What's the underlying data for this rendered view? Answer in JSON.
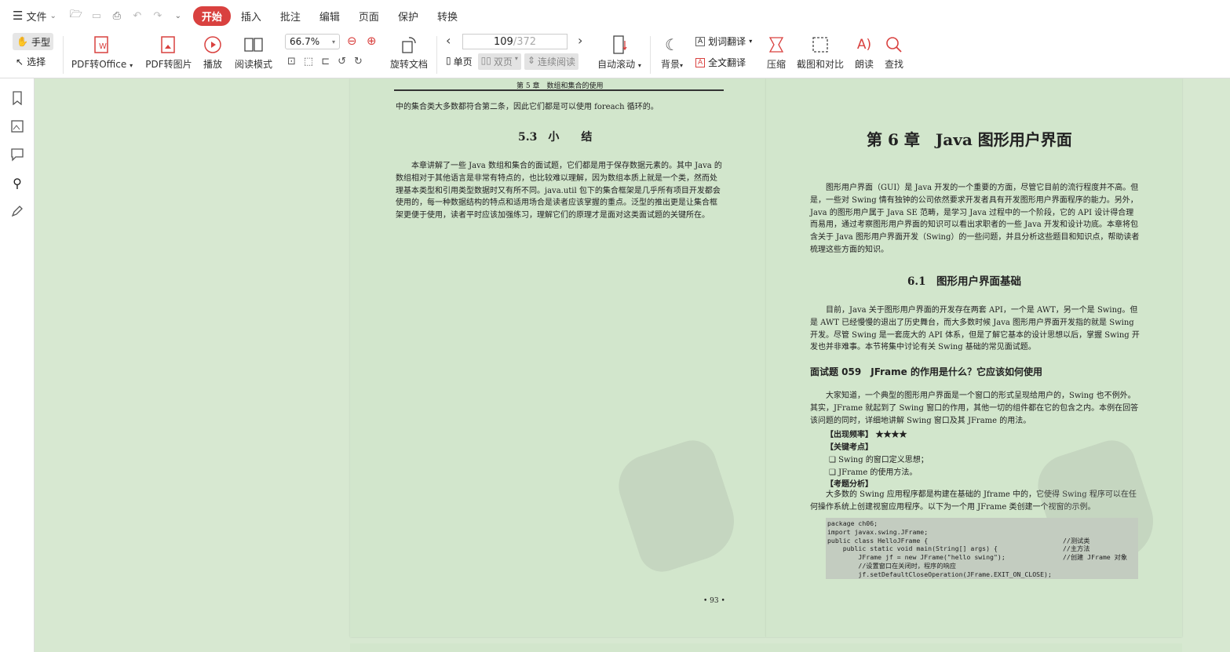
{
  "menubar": {
    "file_label": "文件",
    "tabs": [
      {
        "label": "开始",
        "active": true
      },
      {
        "label": "插入",
        "active": false
      },
      {
        "label": "批注",
        "active": false
      },
      {
        "label": "编辑",
        "active": false
      },
      {
        "label": "页面",
        "active": false
      },
      {
        "label": "保护",
        "active": false
      },
      {
        "label": "转换",
        "active": false
      }
    ]
  },
  "toolbar": {
    "hand_label": "手型",
    "select_label": "选择",
    "pdf_office": "PDF转Office",
    "pdf_image": "PDF转图片",
    "play": "播放",
    "read_mode": "阅读模式",
    "zoom": "66.7%",
    "rotate_doc": "旋转文档",
    "page_current": "109",
    "page_total": "/372",
    "single": "单页",
    "double": "双页",
    "continuous": "连续阅读",
    "auto_scroll": "自动滚动",
    "background": "背景",
    "word_translate": "划词翻译",
    "full_translate": "全文翻译",
    "compress": "压缩",
    "screenshot_compare": "截图和对比",
    "read_aloud": "朗读",
    "find": "查找"
  },
  "colors": {
    "accent": "#d9413f",
    "page_bg": "#d2e6cc",
    "area_bg": "#d7e8d1"
  },
  "left_page": {
    "running_head": "第 5 章　数组和集合的使用",
    "top_line": "中的集合类大多数都符合第二条，因此它们都是可以使用 foreach 循环的。",
    "section_title": "5.3　小　　结",
    "paragraph": "本章讲解了一些 Java 数组和集合的面试题，它们都是用于保存数据元素的。其中 Java 的数组相对于其他语言是非常有特点的，也比较难以理解，因为数组本质上就是一个类，然而处理基本类型和引用类型数据时又有所不同。java.util 包下的集合框架是几乎所有项目开发都会使用的，每一种数据结构的特点和适用场合是读者应该掌握的重点。泛型的推出更是让集合框架更便于使用，读者平时应该加强练习，理解它们的原理才是面对这类面试题的关键所在。",
    "page_number": "• 93 •"
  },
  "right_page": {
    "chapter_title": "第 6 章　Java 图形用户界面",
    "intro": "图形用户界面（GUI）是 Java 开发的一个重要的方面，尽管它目前的流行程度并不高。但是，一些对 Swing 情有独钟的公司依然要求开发者具有开发图形用户界面程序的能力。另外，Java 的图形用户属于 Java SE 范畴，是学习 Java 过程中的一个阶段，它的 API 设计得合理而易用，通过考察图形用户界面的知识可以看出求职者的一些 Java 开发和设计功底。本章将包含关于 Java 图形用户界面开发（Swing）的一些问题，并且分析这些题目和知识点，帮助读者梳理这些方面的知识。",
    "section_title": "6.1　图形用户界面基础",
    "section_para": "目前，Java 关于图形用户界面的开发存在两套 API，一个是 AWT，另一个是 Swing。但是 AWT 已经慢慢的退出了历史舞台，而大多数时候 Java 图形用户界面开发指的就是 Swing 开发。尽管 Swing 是一套庞大的 API 体系，但是了解它基本的设计思想以后，掌握 Swing 开发也并非难事。本节将集中讨论有关 Swing 基础的常见面试题。",
    "question_title": "面试题 059　JFrame 的作用是什么？它应该如何使用",
    "question_para": "大家知道，一个典型的图形用户界面是一个窗口的形式呈现给用户的，Swing 也不例外。其实，JFrame 就起到了 Swing 窗口的作用，其他一切的组件都在它的包含之内。本例在回答该问题的同时，详细地讲解 Swing 窗口及其 JFrame 的用法。",
    "freq_label": "【出现频率】",
    "freq_stars": "★★★★",
    "key_label": "【关键考点】",
    "key_points": [
      "Swing 的窗口定义思想；",
      "JFrame 的使用方法。"
    ],
    "analysis_label": "【考题分析】",
    "analysis_para": "大多数的 Swing 应用程序都是构建在基础的 Jframe 中的，它使得 Swing 程序可以在任何操作系统上创建视窗应用程序。以下为一个用 JFrame 类创建一个视窗的示例。",
    "code_lines": [
      {
        "code": "package ch06;",
        "comment": ""
      },
      {
        "code": "import javax.swing.JFrame;",
        "comment": ""
      },
      {
        "code": "public class HelloJFrame {",
        "comment": "//测试类"
      },
      {
        "code": "    public static void main(String[] args) {",
        "comment": "//主方法"
      },
      {
        "code": "        JFrame jf = new JFrame(\"hello swing\");",
        "comment": "//创建 JFrame 对象"
      },
      {
        "code": "        //设置窗口在关闭时，程序的响应",
        "comment": ""
      },
      {
        "code": "        jf.setDefaultCloseOperation(JFrame.EXIT_ON_CLOSE);",
        "comment": ""
      }
    ]
  }
}
